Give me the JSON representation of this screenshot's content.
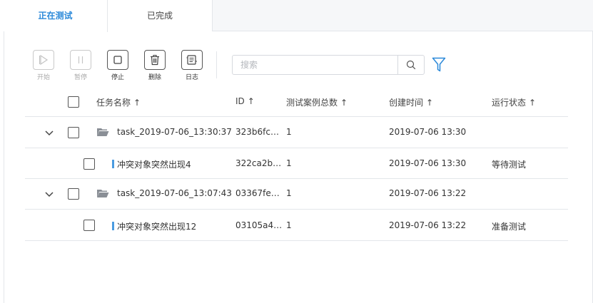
{
  "tabs": [
    {
      "label": "正在测试"
    },
    {
      "label": "已完成"
    }
  ],
  "toolbar": {
    "start": "开始",
    "pause": "暂停",
    "stop": "停止",
    "delete": "删除",
    "log": "日志"
  },
  "search": {
    "placeholder": "搜索",
    "icon": "search-icon",
    "filter_icon": "filter-icon"
  },
  "table": {
    "headers": {
      "name": "任务名称",
      "id": "ID",
      "total": "测试案例总数",
      "created": "创建时间",
      "status": "运行状态",
      "sort_arrow": "↑"
    },
    "rows": [
      {
        "name": "task_2019-07-06_13:30:37",
        "id": "323b6fc…",
        "total": "1",
        "created": "2019-07-06 13:30",
        "status": ""
      },
      {
        "name": "冲突对象突然出现4",
        "id": "322ca2b…",
        "total": "1",
        "created": "2019-07-06 13:30",
        "status": "等待测试"
      },
      {
        "name": "task_2019-07-06_13:07:43",
        "id": "03367fe…",
        "total": "1",
        "created": "2019-07-06 13:22",
        "status": ""
      },
      {
        "name": "冲突对象突然出现12",
        "id": "03105a4…",
        "total": "1",
        "created": "2019-07-06 13:22",
        "status": "准备测试"
      }
    ]
  },
  "colors": {
    "accent": "#2b89d9",
    "tag": "#4a9be0",
    "folder": "#8a8f96"
  }
}
